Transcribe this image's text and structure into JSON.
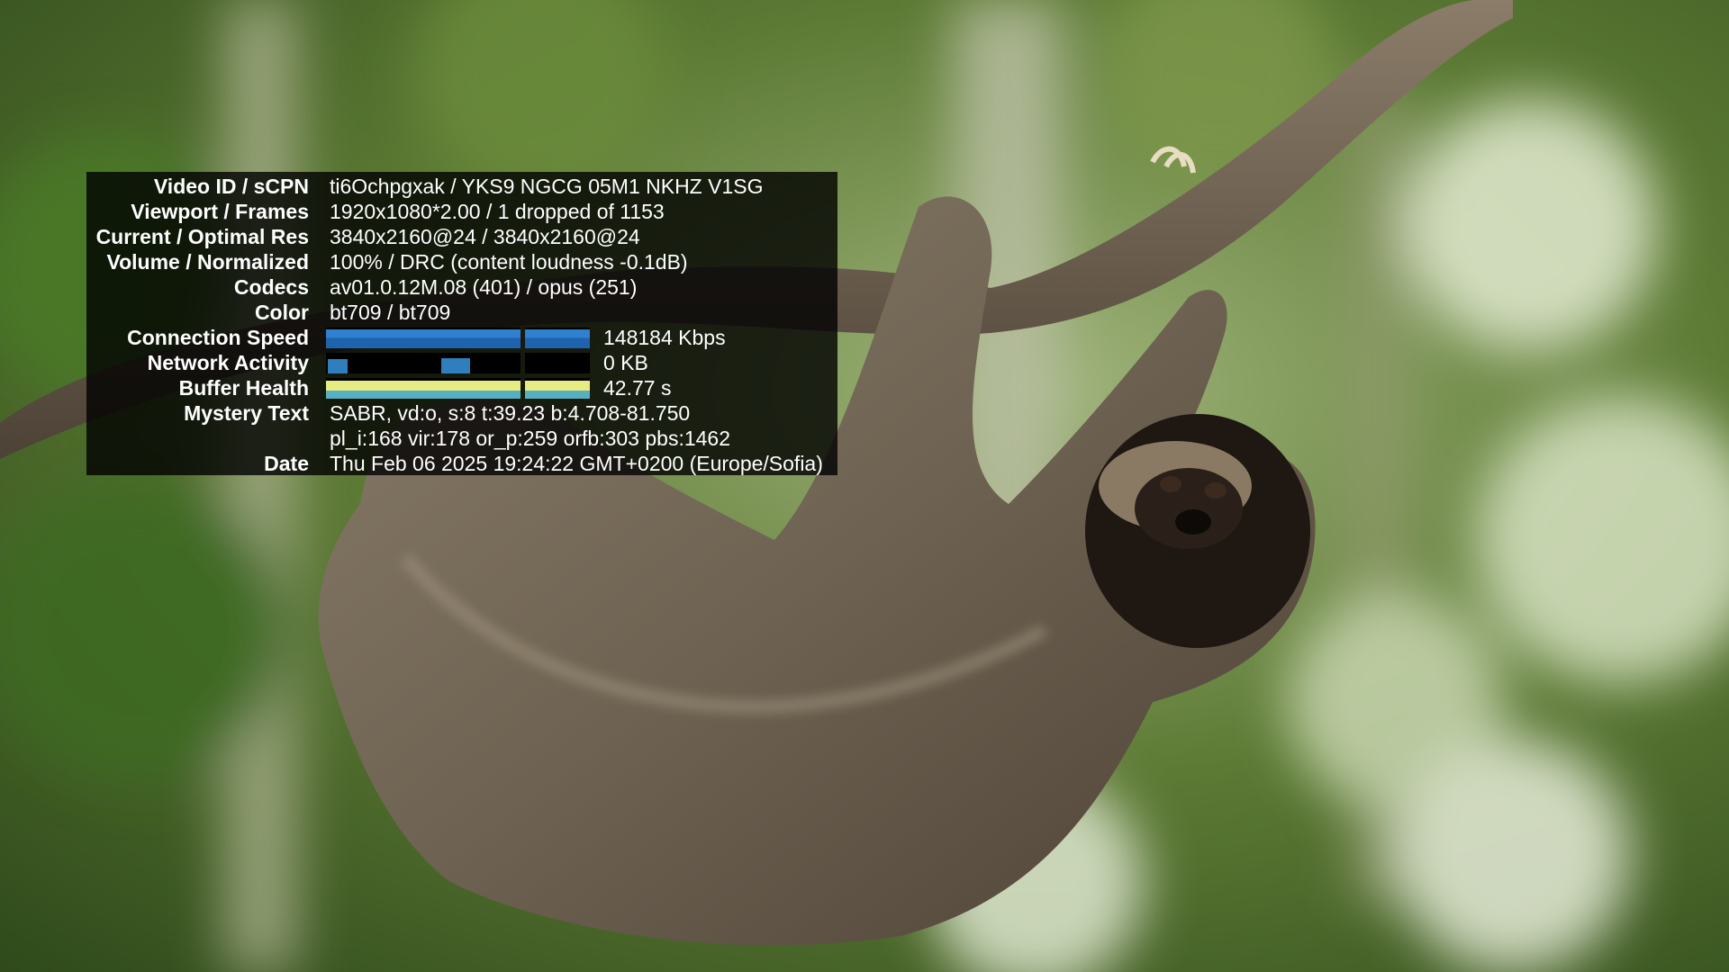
{
  "stats": {
    "rows": [
      {
        "label": "Video ID / sCPN",
        "value": "ti6Ochpgxak / YKS9 NGCG 05M1 NKHZ V1SG"
      },
      {
        "label": "Viewport / Frames",
        "value": "1920x1080*2.00 / 1 dropped of 1153"
      },
      {
        "label": "Current / Optimal Res",
        "value": "3840x2160@24 / 3840x2160@24"
      },
      {
        "label": "Volume / Normalized",
        "value": "100% / DRC (content loudness -0.1dB)"
      },
      {
        "label": "Codecs",
        "value": "av01.0.12M.08 (401) / opus (251)"
      },
      {
        "label": "Color",
        "value": "bt709 / bt709"
      }
    ],
    "connection_speed": {
      "label": "Connection Speed",
      "value": "148184 Kbps",
      "level": 0.9
    },
    "network_activity": {
      "label": "Network Activity",
      "value": "0 KB"
    },
    "buffer_health": {
      "label": "Buffer Health",
      "value": "42.77 s",
      "level": 0.85
    },
    "mystery_text": {
      "label": "Mystery Text",
      "line1": "SABR, vd:o, s:8 t:39.23 b:4.708-81.750",
      "line2": "pl_i:168 vir:178 or_p:259 orfb:303 pbs:1462"
    },
    "date": {
      "label": "Date",
      "value": "Thu Feb 06 2025 19:24:22 GMT+0200 (Europe/Sofia)"
    }
  },
  "colors": {
    "speed_bar": "#1f62ad",
    "network_bar": "#2f7fbf",
    "buffer_bar_top": "#e6ec82",
    "buffer_bar_bottom": "#57b0c2"
  }
}
